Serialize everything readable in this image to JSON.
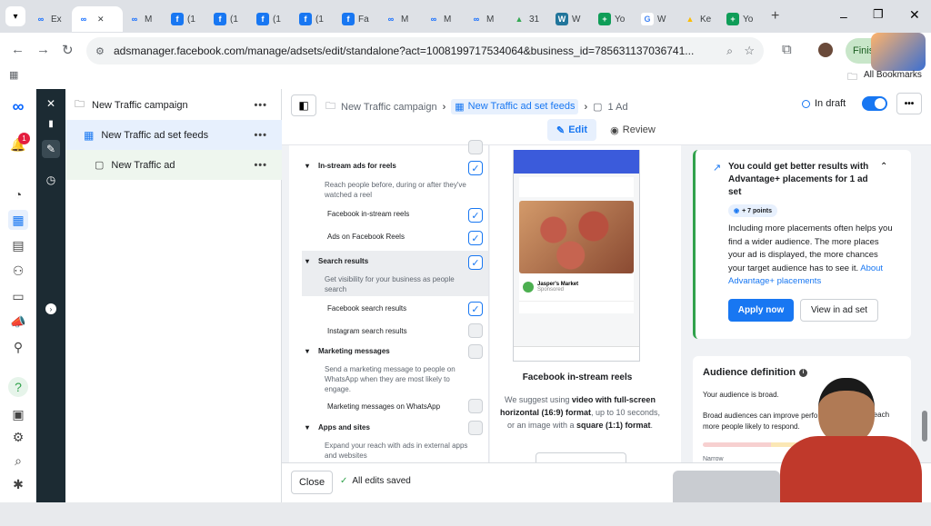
{
  "tabs": [
    {
      "label": "Ex",
      "icon": "meta-icon"
    },
    {
      "label": "",
      "icon": "meta-icon",
      "active": true
    },
    {
      "label": "M",
      "icon": "meta-icon"
    },
    {
      "label": "(1",
      "icon": "facebook-icon"
    },
    {
      "label": "(1",
      "icon": "facebook-icon"
    },
    {
      "label": "(1",
      "icon": "facebook-icon"
    },
    {
      "label": "(1",
      "icon": "facebook-icon"
    },
    {
      "label": "Fa",
      "icon": "facebook-icon"
    },
    {
      "label": "M",
      "icon": "meta-icon"
    },
    {
      "label": "M",
      "icon": "meta-icon"
    },
    {
      "label": "M",
      "icon": "meta-icon"
    },
    {
      "label": "31",
      "icon": "drive-icon"
    },
    {
      "label": "W",
      "icon": "wordpress-icon"
    },
    {
      "label": "Yo",
      "icon": "sheets-icon"
    },
    {
      "label": "W",
      "icon": "google-icon"
    },
    {
      "label": "Ke",
      "icon": "ads-icon"
    },
    {
      "label": "Yo",
      "icon": "sheets-icon"
    }
  ],
  "browser": {
    "url": "adsmanager.facebook.com/manage/adsets/edit/standalone?act=1008199717534064&business_id=785631137036741...",
    "finish_label": "Finis",
    "all_bookmarks": "All Bookmarks"
  },
  "rail": {
    "notification_count": "1"
  },
  "tree": {
    "campaign": "New Traffic campaign",
    "adset": "New Traffic ad set feeds",
    "ad": "New Traffic ad"
  },
  "toolbar": {
    "crumb_campaign": "New Traffic campaign",
    "crumb_adset": "New Traffic ad set feeds",
    "crumb_ad": "1 Ad",
    "status": "In draft",
    "edit": "Edit",
    "review": "Review"
  },
  "placements": {
    "instream_title": "In-stream ads for reels",
    "instream_desc": "Reach people before, during or after they've watched a reel",
    "fb_instream": "Facebook in-stream reels",
    "fb_reels_ads": "Ads on Facebook Reels",
    "search_title": "Search results",
    "search_desc": "Get visibility for your business as people search",
    "fb_search": "Facebook search results",
    "ig_search": "Instagram search results",
    "msg_title": "Marketing messages",
    "msg_desc": "Send a marketing message to people on WhatsApp when they are most likely to engage.",
    "msg_whatsapp": "Marketing messages on WhatsApp",
    "apps_title": "Apps and sites",
    "apps_desc": "Expand your reach with ads in external apps and websites"
  },
  "preview": {
    "page_name": "Jasper's Market",
    "sponsored": "Sponsored",
    "title": "Facebook in-stream reels",
    "suggest_1": "We suggest using ",
    "suggest_bold_1": "video with full-screen horizontal (16:9) format",
    "suggest_2": ", up to 10 seconds, or an image with a ",
    "suggest_bold_2": "square (1:1) format",
    "suggest_3": "."
  },
  "advantage": {
    "title": "You could get better results with Advantage+ placements for 1 ad set",
    "points": "+ 7 points",
    "body": "Including more placements often helps you find a wider audience. The more places your ad is displayed, the more chances your target audience has to see it. ",
    "link": "About Advantage+ placements",
    "apply": "Apply now",
    "view": "View in ad set"
  },
  "audience": {
    "title": "Audience definition",
    "broad": "Your audience is broad.",
    "desc": "Broad audiences can improve perfo",
    "desc2": "more people likely to respond.",
    "desc_tail": "reach",
    "narrow": "Narrow"
  },
  "footer": {
    "close": "Close",
    "saved": "All edits saved"
  },
  "colors": {
    "accent": "#1877f2",
    "dark": "#1c2b33",
    "green": "#31a24c"
  }
}
